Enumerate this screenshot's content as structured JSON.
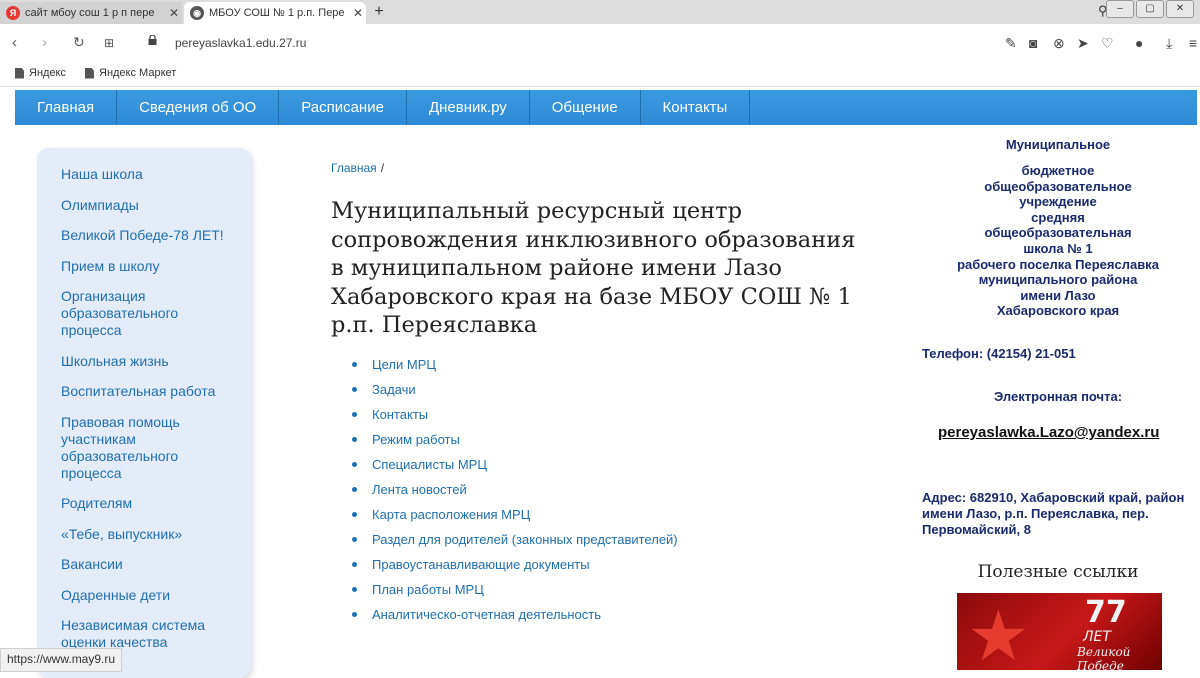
{
  "browser": {
    "tabs": [
      {
        "title": "сайт мбоу сош 1 р п пере",
        "favicon": "yandex-logo-icon"
      },
      {
        "title": "МБОУ СОШ № 1 р.п. Пере",
        "favicon": "globe-icon"
      }
    ],
    "url_domain": "pereyaslavka1.edu.27.ru",
    "bookmarks": [
      "Яндекс",
      "Яндекс Маркет"
    ],
    "status_url": "https://www.may9.ru"
  },
  "site": {
    "nav": [
      "Главная",
      "Сведения об ОО",
      "Расписание",
      "Дневник.ру",
      "Общение",
      "Контакты"
    ],
    "sidebar": [
      "Наша школа",
      "Олимпиады",
      "Великой Победе-78 ЛЕТ!",
      "Прием в школу",
      "Организация образовательного процесса",
      "Школьная жизнь",
      "Воспитательная работа",
      "Правовая помощь участникам образовательного процесса",
      "Родителям",
      "«Тебе, выпускник»",
      "Вакансии",
      "Одаренные дети",
      "Независимая система оценки качества"
    ],
    "breadcrumb": {
      "home": "Главная",
      "sep": "/"
    },
    "title": "Муниципальный ресурсный центр сопровождения инклюзивного образования в муниципальном районе имени Лазо Хабаровского края на базе МБОУ СОШ № 1 р.п. Переяславка",
    "links": [
      "Цели МРЦ",
      "Задачи",
      "Контакты",
      "Режим работы",
      "Специалисты МРЦ",
      "Лента новостей",
      "Карта расположения МРЦ",
      "Раздел для родителей (законных представителей)",
      "Правоустанавливающие документы",
      "План работы МРЦ",
      "Аналитическо-отчетная деятельность"
    ],
    "org": {
      "line1": "Муниципальное",
      "rest": [
        "бюджетное",
        "общеобразовательное",
        "учреждение",
        "средняя",
        "общеобразовательная",
        "школа № 1",
        "рабочего поселка Переяславка",
        "муниципального района",
        "имени Лазо",
        "Хабаровского края"
      ]
    },
    "phone": "Телефон: (42154) 21-051",
    "email_label": "Электронная почта:",
    "email": "pereyaslawka.Lazo@yandex.ru",
    "address": "Адрес: 682910, Хабаровский край, район имени Лазо, р.п. Переяславка, пер. Первомайский, 8",
    "useful_links": "Полезные ссылки",
    "banner": {
      "number": "77",
      "sub": "ЛЕТ",
      "sub2": "Великой Победе"
    }
  },
  "colors": {
    "nav_blue": "#2d8bd6",
    "link_blue": "#1f6fae",
    "org_navy": "#1a2a6c",
    "sidebar_bg": "#e4ecfa"
  }
}
